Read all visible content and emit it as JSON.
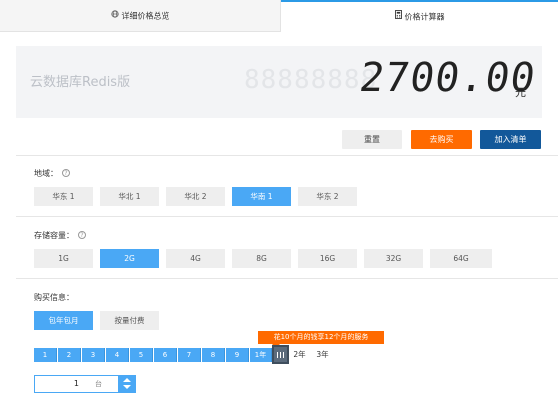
{
  "tabs": {
    "detail": {
      "label": "详细价格总览",
      "icon": "globe-icon"
    },
    "calc": {
      "label": "价格计算器",
      "icon": "calculator-icon"
    }
  },
  "price": {
    "product": "云数据库Redis版",
    "ghost": "88888888",
    "amount": "2700.00",
    "currency": "元"
  },
  "actions": {
    "reset": "重置",
    "buy": "去购买",
    "cart": "加入清单"
  },
  "region": {
    "label": "地域：",
    "help": "?",
    "options": [
      "华东 1",
      "华北 1",
      "华北 2",
      "华南 1",
      "华东 2"
    ],
    "selected": "华南 1"
  },
  "storage": {
    "label": "存储容量：",
    "help": "?",
    "options": [
      "1G",
      "2G",
      "4G",
      "8G",
      "16G",
      "32G",
      "64G"
    ],
    "selected": "2G"
  },
  "purchase": {
    "label": "购买信息：",
    "modes": [
      "包年包月",
      "按量付费"
    ],
    "selected_mode": "包年包月",
    "months": [
      "1",
      "2",
      "3",
      "4",
      "5",
      "6",
      "7",
      "8",
      "9"
    ],
    "years": [
      "1年",
      "2年",
      "3年"
    ],
    "selected_duration": "1年",
    "promo": "花10个月的钱享12个月的服务",
    "quantity": "1",
    "unit": "台"
  },
  "colors": {
    "accent": "#4aa8f5",
    "orange": "#ff6a00",
    "navy": "#12589a"
  }
}
